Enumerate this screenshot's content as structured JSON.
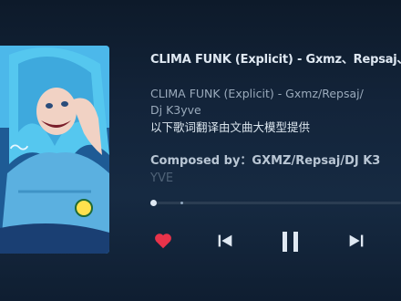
{
  "player": {
    "title": "CLIMA FUNK (Explicit) - Gxmz、Repsaj、",
    "lyrics": [
      "CLIMA FUNK (Explicit) - Gxmz/Repsaj/",
      "Dj K3yve",
      "以下歌词翻译由文曲大模型提供"
    ],
    "composed_line1": "Composed by：GXMZ/Repsaj/DJ K3",
    "composed_line2": "YVE",
    "progress_fraction": 0.01,
    "liked": true,
    "state": "playing"
  },
  "icons": {
    "like": "heart-icon",
    "previous": "skip-previous-icon",
    "play_pause": "pause-icon",
    "next": "skip-next-icon"
  },
  "colors": {
    "heart": "#e8334a",
    "controls": "#dfe8f2",
    "background": "#13243a"
  }
}
